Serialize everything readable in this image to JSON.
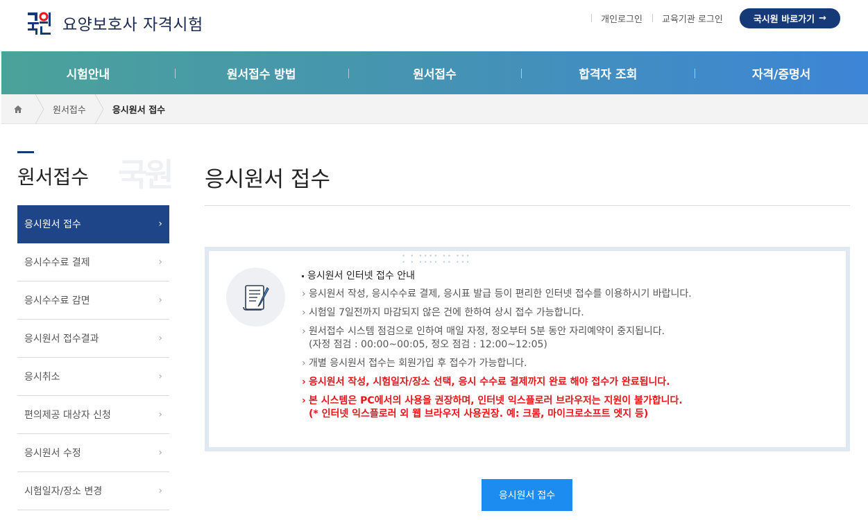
{
  "header": {
    "site_title": "요양보호사 자격시험",
    "logo_text": "국시원",
    "links": [
      "개인로그인",
      "교육기관 로그인"
    ],
    "quick_button": "국시원 바로가기",
    "brand_color": "#163a78"
  },
  "gnb": {
    "items": [
      "시험안내",
      "원서접수 방법",
      "원서접수",
      "합격자 조회",
      "자격/증명서"
    ]
  },
  "breadcrumb": {
    "home_icon": "home-icon",
    "items": [
      "원서접수",
      "응시원서 접수"
    ]
  },
  "lnb": {
    "title": "원서접수",
    "watermark": "국원",
    "items": [
      {
        "label": "응시원서 접수",
        "active": true
      },
      {
        "label": "응시수수료 결제",
        "active": false
      },
      {
        "label": "응시수수료 감면",
        "active": false
      },
      {
        "label": "응시원서 접수결과",
        "active": false
      },
      {
        "label": "응시취소",
        "active": false
      },
      {
        "label": "편의제공 대상자 신청",
        "active": false
      },
      {
        "label": "응시원서 수정",
        "active": false
      },
      {
        "label": "시험일자/장소 변경",
        "active": false
      }
    ]
  },
  "content": {
    "page_title": "응시원서 접수",
    "info": {
      "icon": "document-pen-icon",
      "heading": "응시원서 인터넷 접수 안내",
      "lines": [
        "응시원서 작성, 응시수수료 결제, 응시표 발급 등이 편리한 인터넷 접수를 이용하시기 바랍니다.",
        "시험일 7일전까지 마감되지 않은 건에 한하여 상시 접수 가능합니다.",
        "원서접수 시스템 점검으로 인하여 매일 자정, 정오부터 5분 동안 자리예약이 중지됩니다.",
        "(자정 점검 : 00:00~00:05, 정오 점검 : 12:00~12:05)",
        "개별 응시원서 접수는 회원가입 후 접수가 가능합니다.",
        "응시원서 작성, 시험일자/장소 선택, 응시 수수료 결제까지 완료 해야 접수가 완료됩니다.",
        "본 시스템은 PC에서의 사용을 권장하며, 인터넷 익스플로러 브라우저는 지원이 불가합니다.",
        "(* 인터넷 익스플로러 외 웹 브라우저 사용권장. 예: 크롬, 마이크로소프트 엣지 등)"
      ],
      "warning_color": "#e8151b"
    },
    "apply_button": "응시원서 접수",
    "button_color": "#1c8cf0"
  }
}
